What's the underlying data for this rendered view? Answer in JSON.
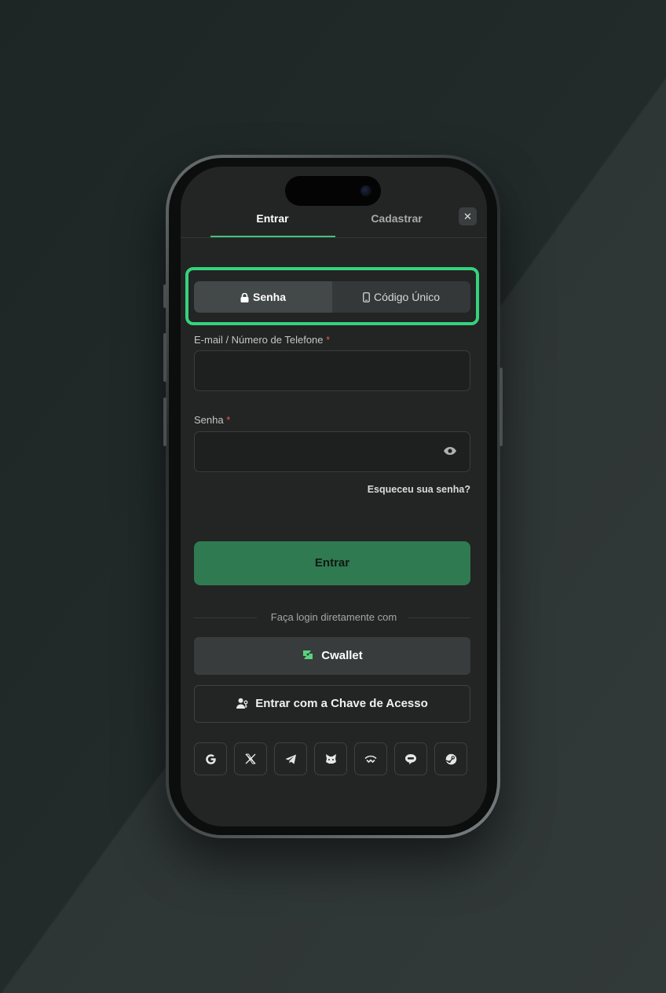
{
  "tabs": {
    "login_label": "Entrar",
    "register_label": "Cadastrar",
    "close_glyph": "✕"
  },
  "method_toggle": {
    "password_label": "Senha",
    "password_icon": "lock-icon",
    "otp_label": "Código Único",
    "otp_icon": "phone-icon",
    "highlight_color": "#33d47c"
  },
  "form": {
    "email_label": "E-mail / Número de Telefone",
    "password_label": "Senha",
    "required_mark": "*",
    "email_value": "",
    "password_value": "",
    "forgot_label": "Esqueceu sua senha?",
    "submit_label": "Entrar"
  },
  "alt_login": {
    "divider_text": "Faça login diretamente com",
    "cwallet_label": "Cwallet",
    "passkey_label": "Entrar com a Chave de Acesso"
  },
  "social_icons": [
    "google-icon",
    "x-icon",
    "telegram-icon",
    "metamask-icon",
    "wallet-connect-icon",
    "line-icon",
    "steam-icon"
  ],
  "colors": {
    "accent": "#3fc47a",
    "primary_button": "#2f7a50",
    "required": "#e0555b"
  }
}
